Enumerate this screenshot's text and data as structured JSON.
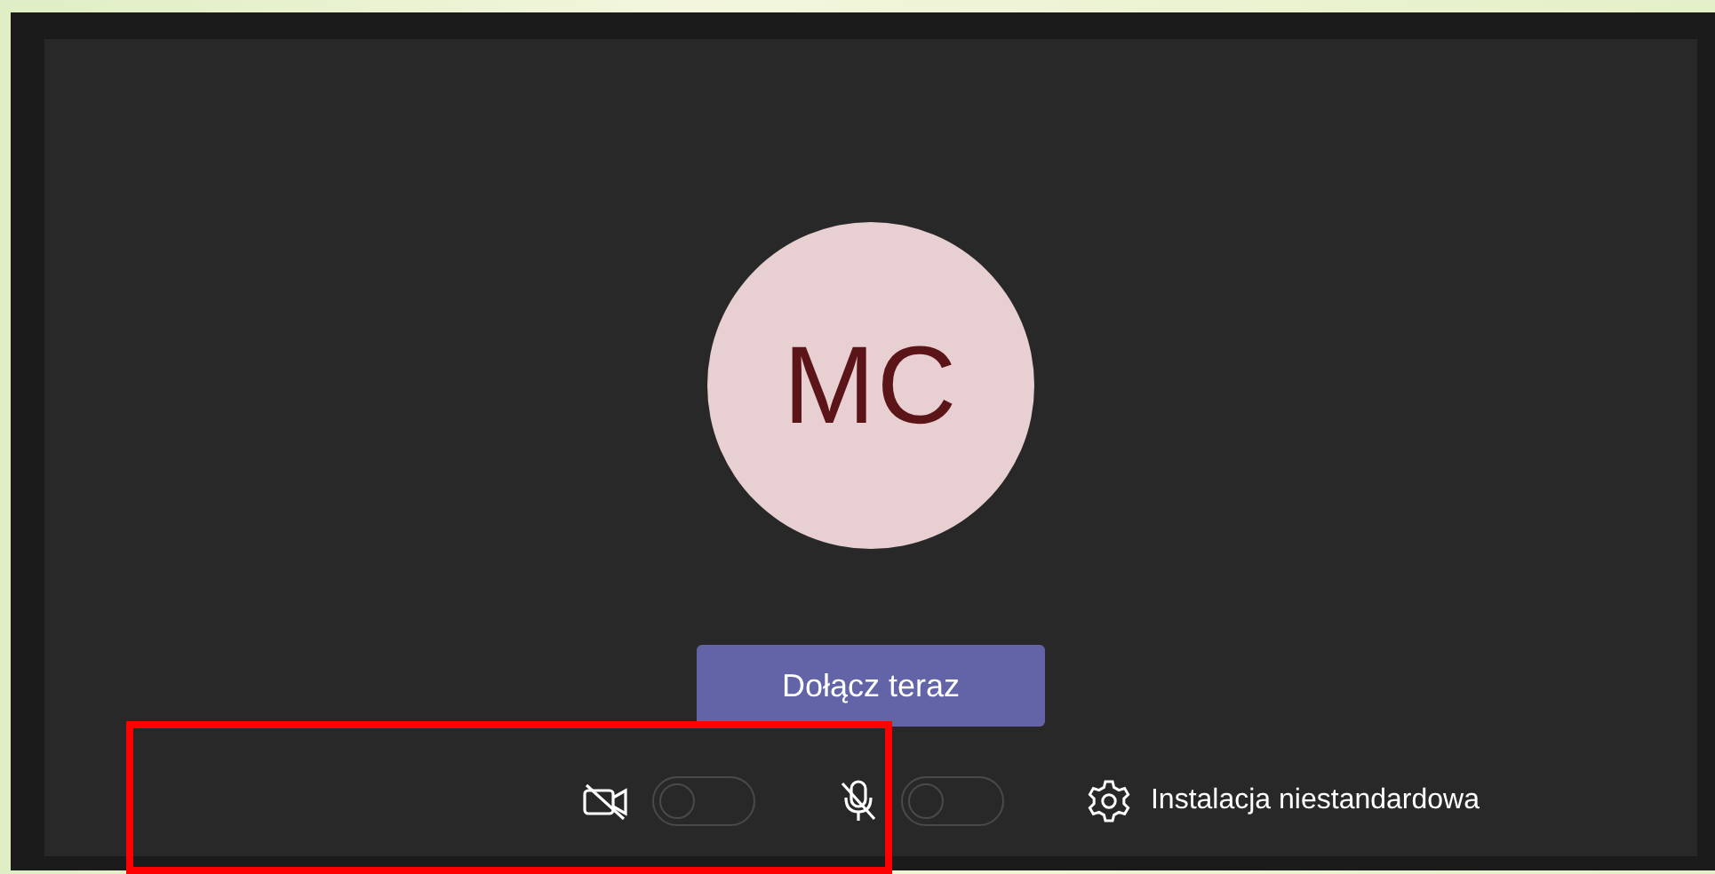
{
  "avatar": {
    "initials": "MC"
  },
  "join_button": {
    "label": "Dołącz teraz"
  },
  "controls": [
    {
      "kind": "camera",
      "on": false
    },
    {
      "kind": "microphone",
      "on": false
    }
  ],
  "device_settings": {
    "label": "Instalacja niestandardowa"
  },
  "highlight": {
    "color": "#ff0000"
  }
}
